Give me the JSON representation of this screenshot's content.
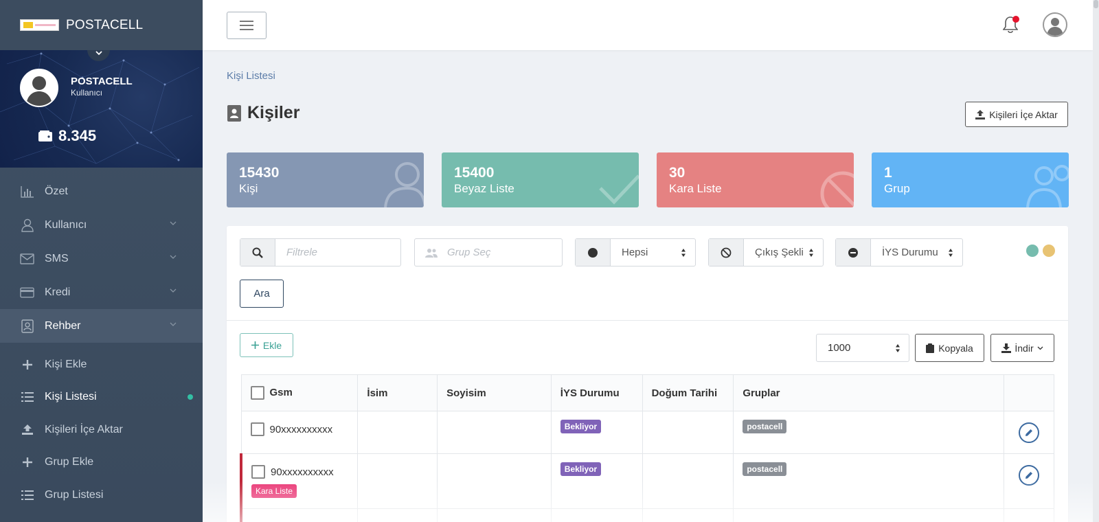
{
  "app": {
    "brand_name": "POSTACELL"
  },
  "profile": {
    "name": "POSTACELL",
    "role": "Kullanıcı",
    "balance": "8.345"
  },
  "sidebar": {
    "items": [
      {
        "label": "Özet",
        "icon": "chart-icon"
      },
      {
        "label": "Kullanıcı",
        "icon": "user-icon"
      },
      {
        "label": "SMS",
        "icon": "envelope-icon"
      },
      {
        "label": "Kredi",
        "icon": "credit-card-icon"
      },
      {
        "label": "Rehber",
        "icon": "address-book-icon"
      }
    ],
    "subitems": [
      {
        "label": "Kişi Ekle",
        "icon": "plus-icon"
      },
      {
        "label": "Kişi Listesi",
        "icon": "list-icon"
      },
      {
        "label": "Kişileri İçe Aktar",
        "icon": "upload-icon"
      },
      {
        "label": "Grup Ekle",
        "icon": "plus-icon"
      },
      {
        "label": "Grup Listesi",
        "icon": "list-icon"
      }
    ]
  },
  "breadcrumb": "Kişi Listesi",
  "page": {
    "title": "Kişiler",
    "import_label": "Kişileri İçe Aktar"
  },
  "stats": [
    {
      "value": "15430",
      "label": "Kişi",
      "color": "#8597b3"
    },
    {
      "value": "15400",
      "label": "Beyaz Liste",
      "color": "#76bcae"
    },
    {
      "value": "30",
      "label": "Kara Liste",
      "color": "#e58282"
    },
    {
      "value": "1",
      "label": "Grup",
      "color": "#62b4f5"
    }
  ],
  "filters": {
    "search_placeholder": "Filtrele",
    "group_placeholder": "Grup Seç",
    "status_value": "Hepsi",
    "exit_value": "Çıkış Şekli",
    "iys_value": "İYS Durumu",
    "search_button": "Ara",
    "theme_colors": [
      "#76bcae",
      "#e8c373"
    ]
  },
  "toolbar": {
    "add_label": "Ekle",
    "page_size": "1000",
    "copy_label": "Kopyala",
    "download_label": "İndir"
  },
  "table": {
    "headers": [
      "Gsm",
      "İsim",
      "Soyisim",
      "İYS Durumu",
      "Doğum Tarihi",
      "Gruplar"
    ],
    "rows": [
      {
        "gsm": "90xxxxxxxxxx",
        "name": "",
        "surname": "",
        "iys": "Bekliyor",
        "birth": "",
        "group": "postacell",
        "flag": ""
      },
      {
        "gsm": "90xxxxxxxxxx",
        "name": "",
        "surname": "",
        "iys": "Bekliyor",
        "birth": "",
        "group": "postacell",
        "flag": "Kara Liste"
      }
    ]
  }
}
